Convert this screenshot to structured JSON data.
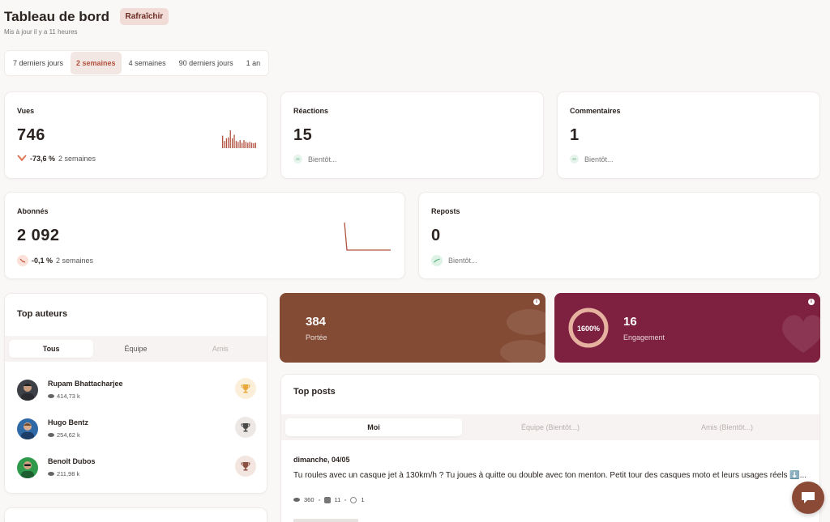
{
  "header": {
    "title": "Tableau de bord",
    "refresh_label": "Rafraîchir",
    "updated": "Mis à jour il y a 11 heures"
  },
  "ranges": [
    {
      "label": "7 derniers jours",
      "active": false
    },
    {
      "label": "2 semaines",
      "active": true
    },
    {
      "label": "4 semaines",
      "active": false
    },
    {
      "label": "90 derniers jours",
      "active": false
    },
    {
      "label": "1 an",
      "active": false
    }
  ],
  "stats": {
    "views": {
      "label": "Vues",
      "value": "746",
      "change": "-73,6 %",
      "period": "2 semaines",
      "trend": [
        0.7,
        0.4,
        0.55,
        0.6,
        1.0,
        0.55,
        0.75,
        0.4,
        0.35,
        0.45,
        0.3,
        0.45,
        0.35,
        0.3,
        0.35,
        0.3,
        0.28,
        0.3
      ]
    },
    "reactions": {
      "label": "Réactions",
      "value": "15",
      "soon": "Bientôt..."
    },
    "comments": {
      "label": "Commentaires",
      "value": "1",
      "soon": "Bientôt..."
    },
    "followers": {
      "label": "Abonnés",
      "value": "2 092",
      "change": "-0,1 %",
      "period": "2 semaines"
    },
    "reposts": {
      "label": "Reposts",
      "value": "0",
      "soon": "Bientôt..."
    }
  },
  "colors": {
    "accent": "#b1513e",
    "reach_bg": "#834a34",
    "engagement_bg": "#7e2140",
    "chat": "#8b4a36"
  },
  "reach": {
    "value": "384",
    "label": "Portée"
  },
  "engagement": {
    "value": "16",
    "label": "Engagement",
    "ring_label": "1600%",
    "ring_fraction": 1.0
  },
  "top_authors": {
    "title": "Top auteurs",
    "tabs": [
      {
        "label": "Tous",
        "state": "active"
      },
      {
        "label": "Équipe",
        "state": "normal"
      },
      {
        "label": "Amis",
        "state": "disabled"
      }
    ],
    "authors": [
      {
        "name": "Rupam Bhattacharjee",
        "views": "414,73 k",
        "rank": 1,
        "avatar_bg": "#3d4046",
        "medal": "#e8a83a",
        "medal_bg": "#fbefd9"
      },
      {
        "name": "Hugo Bentz",
        "views": "254,62 k",
        "rank": 2,
        "avatar_bg": "#2f6aa6",
        "medal": "#4a4a4a",
        "medal_bg": "#ede8e6"
      },
      {
        "name": "Benoît Dubos",
        "views": "211,98 k",
        "rank": 3,
        "avatar_bg": "#2f9a4c",
        "medal": "#8a5040",
        "medal_bg": "#f3e5df"
      }
    ]
  },
  "top_posts": {
    "title": "Top posts",
    "tabs": [
      {
        "label": "Moi",
        "state": "active"
      },
      {
        "label": "Équipe (Bientôt...)",
        "state": "disabled"
      },
      {
        "label": "Amis (Bientôt...)",
        "state": "disabled"
      }
    ],
    "posts": [
      {
        "date": "dimanche, 04/05",
        "text": "Tu roules avec un casque jet à 130km/h ? Tu joues à quitte ou double avec ton menton. Petit tour des casques moto et leurs usages réels ⬇️...",
        "views": "360",
        "reactions": "11",
        "comments": "1"
      }
    ]
  }
}
